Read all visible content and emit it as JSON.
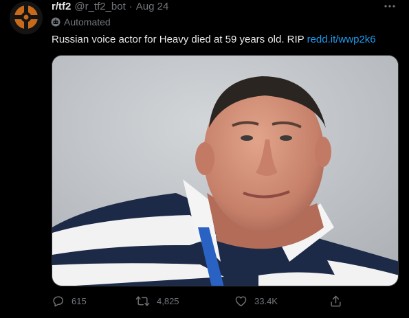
{
  "author": {
    "display_name": "r/tf2",
    "handle": "@r_tf2_bot",
    "separator": "·",
    "date": "Aug 24",
    "avatar_icon": "tf2-logo-icon"
  },
  "automated_label": "Automated",
  "tweet": {
    "text": "Russian voice actor for Heavy died at 59 years old. RIP",
    "link": "redd.it/wwp2k6"
  },
  "media": {
    "alt": "photo"
  },
  "actions": {
    "reply": {
      "icon": "reply-icon",
      "count": "615"
    },
    "retweet": {
      "icon": "retweet-icon",
      "count": "4,825"
    },
    "like": {
      "icon": "heart-icon",
      "count": "33.4K"
    },
    "share": {
      "icon": "share-icon"
    }
  },
  "more_icon": "more-icon",
  "colors": {
    "background": "#000000",
    "text": "#e7e9ea",
    "secondary": "#71767b",
    "link": "#1d9bf0"
  }
}
